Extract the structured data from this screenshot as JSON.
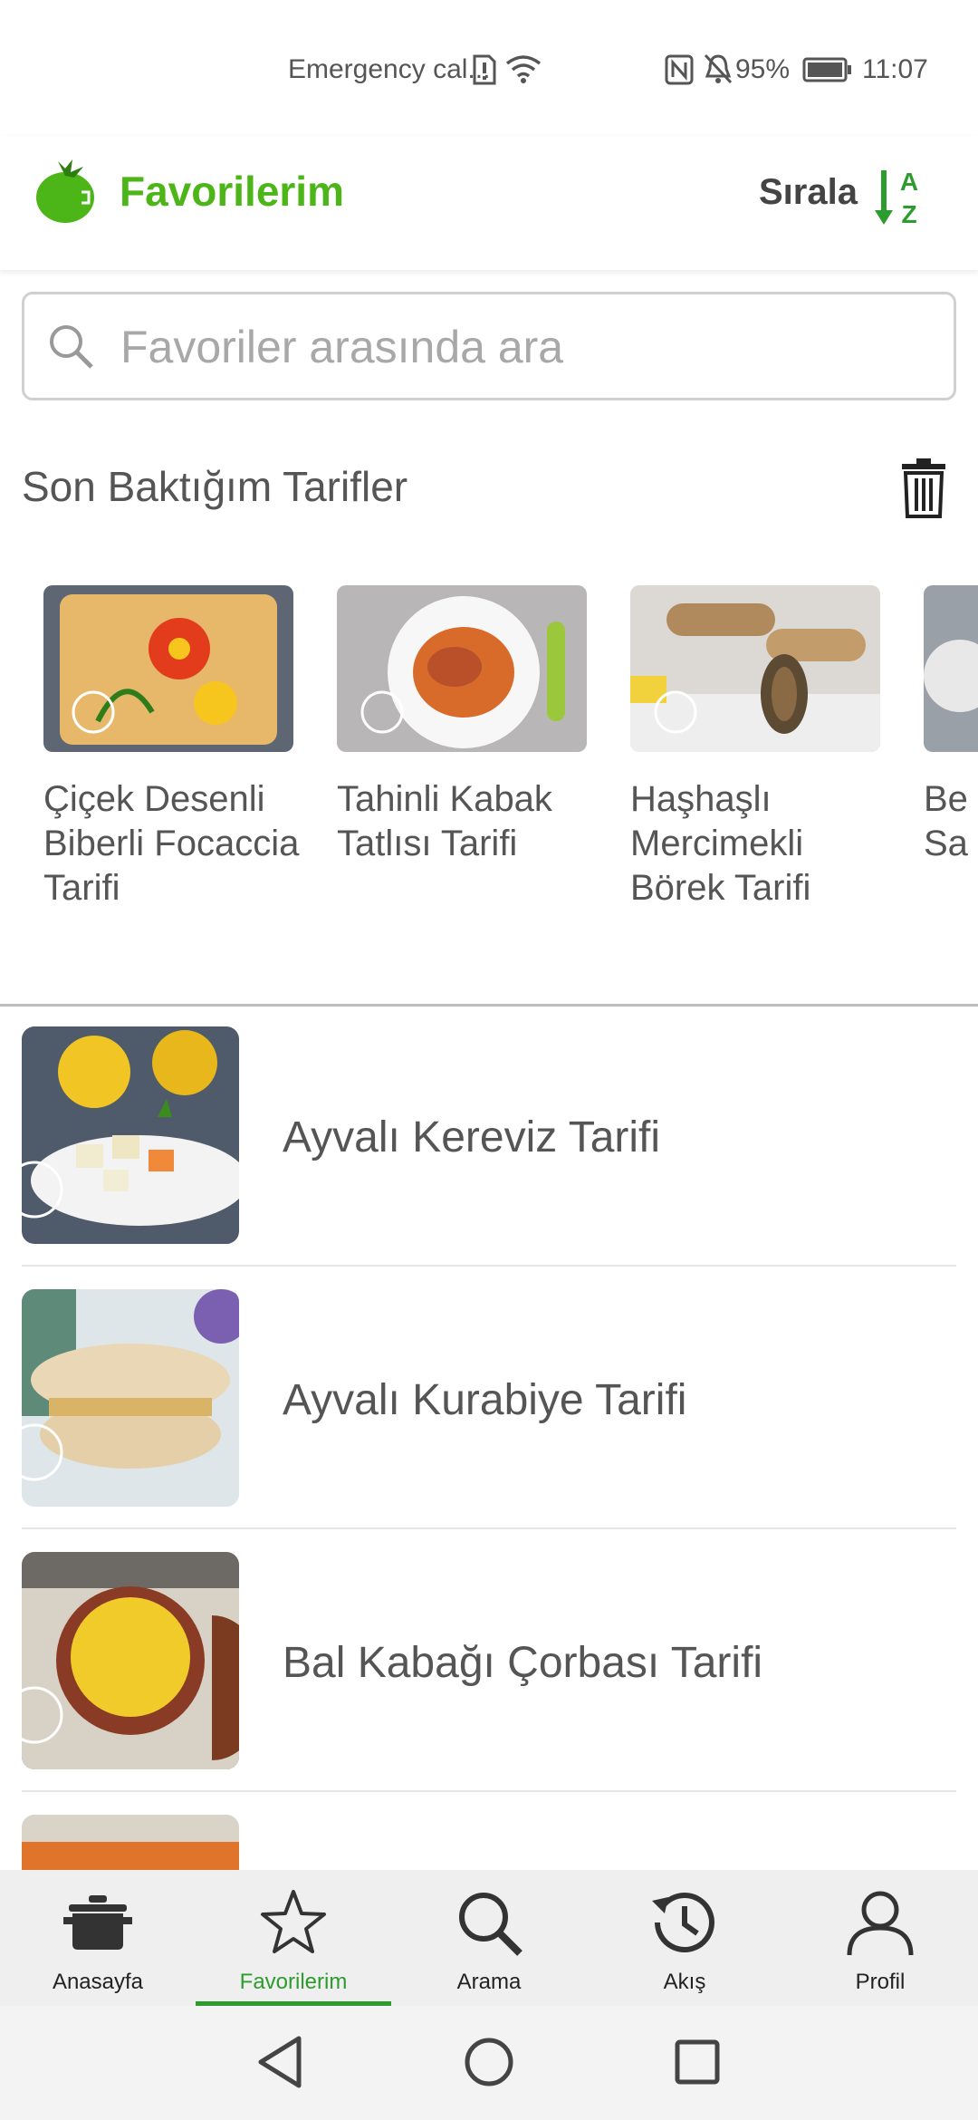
{
  "status_bar": {
    "carrier": "Emergency cal...",
    "battery": "95%",
    "time": "11:07"
  },
  "app_bar": {
    "title": "Favorilerim",
    "sort_label": "Sırala",
    "sort_icon_letters": [
      "A",
      "Z"
    ]
  },
  "search": {
    "placeholder": "Favoriler arasında ara",
    "value": ""
  },
  "recent": {
    "title": "Son Baktığım Tarifler",
    "items": [
      {
        "title": "Çiçek Desenli Biberli Focaccia Tarifi",
        "icon": "focaccia-image"
      },
      {
        "title": "Tahinli Kabak Tatlısı Tarifi",
        "icon": "pumpkin-dessert-image"
      },
      {
        "title": "Haşhaşlı Mercimekli Börek Tarifi",
        "icon": "borek-image"
      },
      {
        "title": "Be Sa",
        "icon": "recipe-image"
      }
    ]
  },
  "favorites": [
    {
      "title": "Ayvalı Kereviz Tarifi",
      "icon": "celery-dish-image"
    },
    {
      "title": "Ayvalı Kurabiye Tarifi",
      "icon": "cookie-image"
    },
    {
      "title": "Bal Kabağı Çorbası Tarifi",
      "icon": "soup-image"
    },
    {
      "title": "",
      "icon": "recipe-image"
    }
  ],
  "bottom_nav": [
    {
      "label": "Anasayfa",
      "icon": "pot-icon",
      "active": false
    },
    {
      "label": "Favorilerim",
      "icon": "star-icon",
      "active": true
    },
    {
      "label": "Arama",
      "icon": "search-icon",
      "active": false
    },
    {
      "label": "Akış",
      "icon": "history-icon",
      "active": false
    },
    {
      "label": "Profil",
      "icon": "person-icon",
      "active": false
    }
  ],
  "colors": {
    "accent": "#4cb518",
    "nav_active": "#2e9b2e",
    "text": "#555555",
    "nav_bg": "#efefef"
  }
}
